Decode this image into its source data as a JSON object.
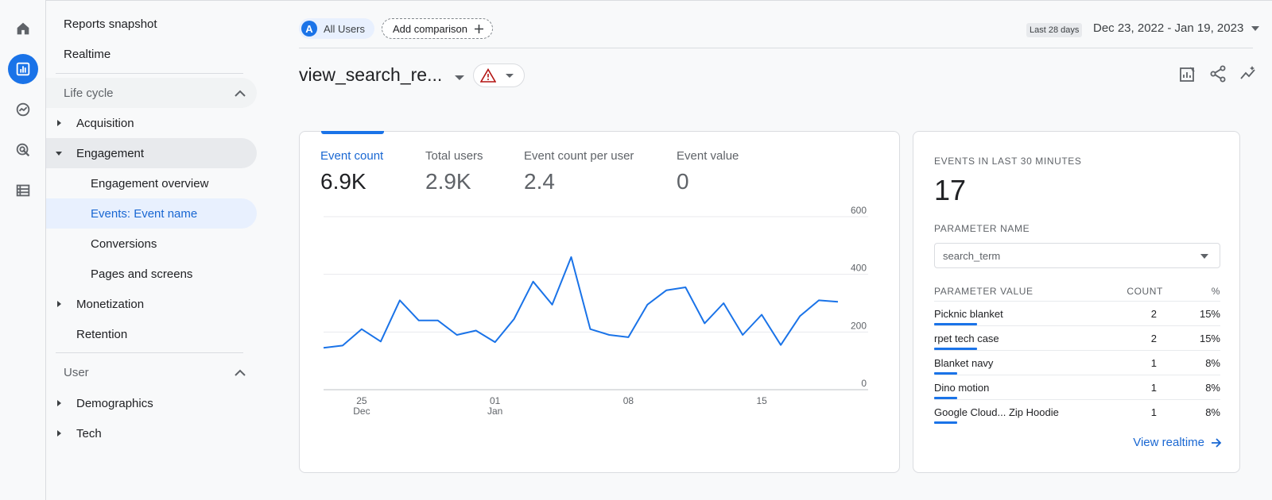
{
  "rail": {
    "items": [
      {
        "name": "home"
      },
      {
        "name": "reports",
        "active": true
      },
      {
        "name": "explore"
      },
      {
        "name": "advertising"
      },
      {
        "name": "configure"
      }
    ]
  },
  "nav": {
    "top_items": [
      "Reports snapshot",
      "Realtime"
    ],
    "lifecycle_label": "Life cycle",
    "acquisition": "Acquisition",
    "engagement": "Engagement",
    "engagement_children": [
      "Engagement overview",
      "Events: Event name",
      "Conversions",
      "Pages and screens"
    ],
    "monetization": "Monetization",
    "retention": "Retention",
    "user_label": "User",
    "demographics": "Demographics",
    "tech": "Tech"
  },
  "header": {
    "segment_avatar": "A",
    "segment_label": "All Users",
    "compare_label": "Add comparison",
    "date_badge": "Last 28 days",
    "date_range": "Dec 23, 2022 - Jan 19, 2023"
  },
  "title": {
    "text": "view_search_re...",
    "warning_color": "#b31412"
  },
  "metrics": [
    {
      "label": "Event count",
      "value": "6.9K",
      "active": true
    },
    {
      "label": "Total users",
      "value": "2.9K"
    },
    {
      "label": "Event count per user",
      "value": "2.4"
    },
    {
      "label": "Event value",
      "value": "0"
    }
  ],
  "chart_data": {
    "type": "line",
    "x_tick_labels": [
      {
        "day": "25",
        "month": "Dec"
      },
      {
        "day": "01",
        "month": "Jan"
      },
      {
        "day": "08",
        "month": ""
      },
      {
        "day": "15",
        "month": ""
      }
    ],
    "ylim": [
      0,
      600
    ],
    "y_ticks": [
      "600",
      "400",
      "200",
      "0"
    ],
    "series": [
      {
        "x": [
          "Dec 23",
          "Dec 24",
          "Dec 25",
          "Dec 26",
          "Dec 27",
          "Dec 28",
          "Dec 29",
          "Dec 30",
          "Dec 31",
          "Jan 1",
          "Jan 2",
          "Jan 3",
          "Jan 4",
          "Jan 5",
          "Jan 6",
          "Jan 7",
          "Jan 8",
          "Jan 9",
          "Jan 10",
          "Jan 11",
          "Jan 12",
          "Jan 13",
          "Jan 14",
          "Jan 15",
          "Jan 16",
          "Jan 17",
          "Jan 18",
          "Jan 19"
        ],
        "values": [
          145,
          153,
          210,
          167,
          310,
          240,
          240,
          190,
          205,
          165,
          245,
          375,
          295,
          460,
          210,
          190,
          182,
          295,
          345,
          355,
          230,
          300,
          190,
          260,
          155,
          255,
          310,
          305
        ],
        "color": "#1a73e8"
      }
    ],
    "grid": true,
    "axis_side": "right"
  },
  "realtime": {
    "heading": "EVENTS IN LAST 30 MINUTES",
    "count": "17",
    "param_heading": "PARAMETER NAME",
    "param_value": "search_term",
    "col_value": "PARAMETER VALUE",
    "col_count": "COUNT",
    "col_pct": "%",
    "rows": [
      {
        "name": "Picknic blanket",
        "count": "2",
        "pct": "15%",
        "share": 0.15
      },
      {
        "name": "rpet tech case",
        "count": "2",
        "pct": "15%",
        "share": 0.15
      },
      {
        "name": "Blanket navy",
        "count": "1",
        "pct": "8%",
        "share": 0.08
      },
      {
        "name": "Dino motion",
        "count": "1",
        "pct": "8%",
        "share": 0.08
      },
      {
        "name": "Google Cloud... Zip Hoodie",
        "count": "1",
        "pct": "8%",
        "share": 0.08
      }
    ],
    "link_label": "View realtime"
  }
}
